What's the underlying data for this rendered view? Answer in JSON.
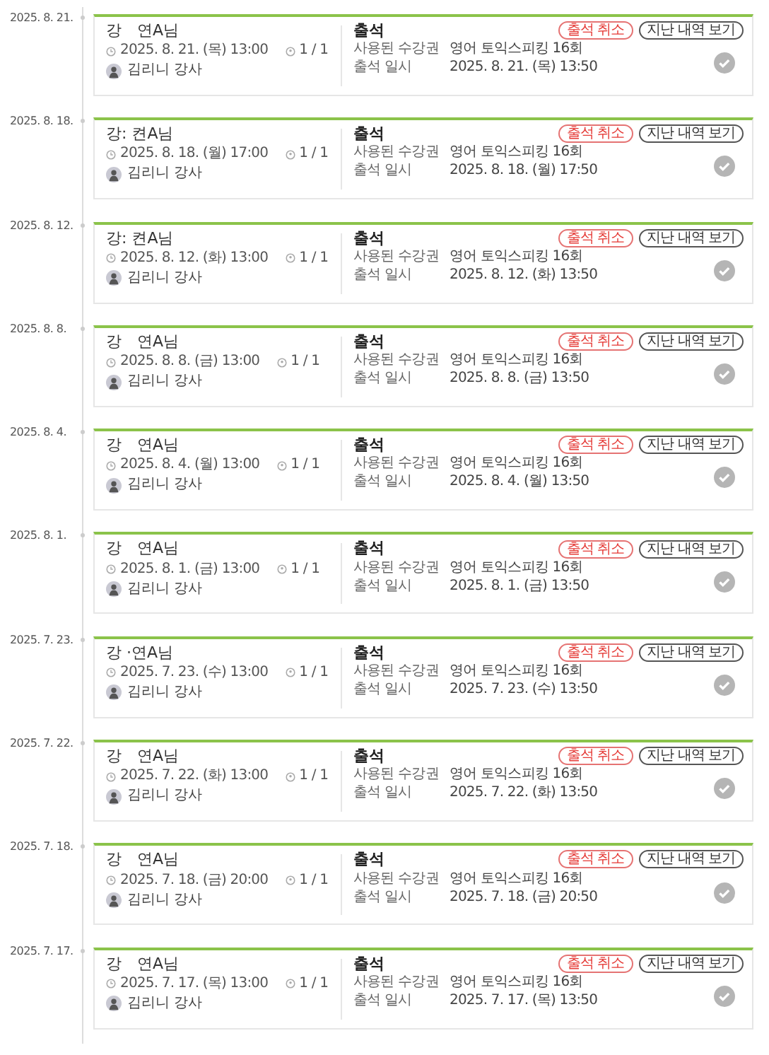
{
  "entries": [
    {
      "date": "2025. 8. 21.",
      "name": "강　연A님",
      "session": "2025. 8. 21. (목) 13:00",
      "count": "1 / 1",
      "teacher": "김리니 강사",
      "status": "출석",
      "ticket_label": "사용된 수강권",
      "ticket": "영어 토익스피킹 16회",
      "time_label": "출석 일시",
      "time": "2025. 8. 21. (목) 13:50",
      "cancel": "출석 취소",
      "history": "지난 내역 보기"
    },
    {
      "date": "2025. 8. 18.",
      "name": "강: 켠A님",
      "session": "2025. 8. 18. (월) 17:00",
      "count": "1 / 1",
      "teacher": "김리니 강사",
      "status": "출석",
      "ticket_label": "사용된 수강권",
      "ticket": "영어 토익스피킹 16회",
      "time_label": "출석 일시",
      "time": "2025. 8. 18. (월) 17:50",
      "cancel": "출석 취소",
      "history": "지난 내역 보기"
    },
    {
      "date": "2025. 8. 12.",
      "name": "강: 켠A님",
      "session": "2025. 8. 12. (화) 13:00",
      "count": "1 / 1",
      "teacher": "김리니 강사",
      "status": "출석",
      "ticket_label": "사용된 수강권",
      "ticket": "영어 토익스피킹 16회",
      "time_label": "출석 일시",
      "time": "2025. 8. 12. (화) 13:50",
      "cancel": "출석 취소",
      "history": "지난 내역 보기"
    },
    {
      "date": "2025. 8. 8.",
      "name": "강　연A님",
      "session": "2025. 8. 8. (금) 13:00",
      "count": "1 / 1",
      "teacher": "김리니 강사",
      "status": "출석",
      "ticket_label": "사용된 수강권",
      "ticket": "영어 토익스피킹 16회",
      "time_label": "출석 일시",
      "time": "2025. 8. 8. (금) 13:50",
      "cancel": "출석 취소",
      "history": "지난 내역 보기"
    },
    {
      "date": "2025. 8. 4.",
      "name": "강　연A님",
      "session": "2025. 8. 4. (월) 13:00",
      "count": "1 / 1",
      "teacher": "김리니 강사",
      "status": "출석",
      "ticket_label": "사용된 수강권",
      "ticket": "영어 토익스피킹 16회",
      "time_label": "출석 일시",
      "time": "2025. 8. 4. (월) 13:50",
      "cancel": "출석 취소",
      "history": "지난 내역 보기"
    },
    {
      "date": "2025. 8. 1.",
      "name": "강　연A님",
      "session": "2025. 8. 1. (금) 13:00",
      "count": "1 / 1",
      "teacher": "김리니 강사",
      "status": "출석",
      "ticket_label": "사용된 수강권",
      "ticket": "영어 토익스피킹 16회",
      "time_label": "출석 일시",
      "time": "2025. 8. 1. (금) 13:50",
      "cancel": "출석 취소",
      "history": "지난 내역 보기"
    },
    {
      "date": "2025. 7. 23.",
      "name": "강 ·연A님",
      "session": "2025. 7. 23. (수) 13:00",
      "count": "1 / 1",
      "teacher": "김리니 강사",
      "status": "출석",
      "ticket_label": "사용된 수강권",
      "ticket": "영어 토익스피킹 16회",
      "time_label": "출석 일시",
      "time": "2025. 7. 23. (수) 13:50",
      "cancel": "출석 취소",
      "history": "지난 내역 보기"
    },
    {
      "date": "2025. 7. 22.",
      "name": "강　연A님",
      "session": "2025. 7. 22. (화) 13:00",
      "count": "1 / 1",
      "teacher": "김리니 강사",
      "status": "출석",
      "ticket_label": "사용된 수강권",
      "ticket": "영어 토익스피킹 16회",
      "time_label": "출석 일시",
      "time": "2025. 7. 22. (화) 13:50",
      "cancel": "출석 취소",
      "history": "지난 내역 보기"
    },
    {
      "date": "2025. 7. 18.",
      "name": "강　연A님",
      "session": "2025. 7. 18. (금) 20:00",
      "count": "1 / 1",
      "teacher": "김리니 강사",
      "status": "출석",
      "ticket_label": "사용된 수강권",
      "ticket": "영어 토익스피킹 16회",
      "time_label": "출석 일시",
      "time": "2025. 7. 18. (금) 20:50",
      "cancel": "출석 취소",
      "history": "지난 내역 보기"
    },
    {
      "date": "2025. 7. 17.",
      "name": "강　연A님",
      "session": "2025. 7. 17. (목) 13:00",
      "count": "1 / 1",
      "teacher": "김리니 강사",
      "status": "출석",
      "ticket_label": "사용된 수강권",
      "ticket": "영어 토익스피킹 16회",
      "time_label": "출석 일시",
      "time": "2025. 7. 17. (목) 13:50",
      "cancel": "출석 취소",
      "history": "지난 내역 보기"
    }
  ]
}
